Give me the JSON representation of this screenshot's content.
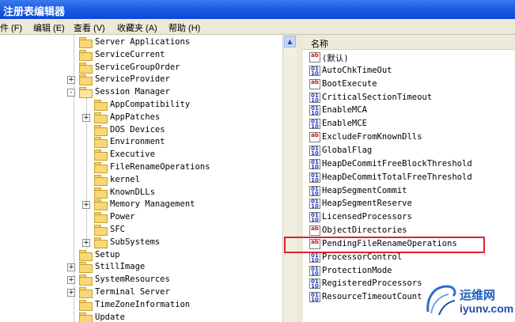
{
  "window": {
    "title": "注册表编辑器"
  },
  "menu": [
    {
      "label": "件 (F)"
    },
    {
      "label": "编辑 (E)"
    },
    {
      "label": "查看 (V)"
    },
    {
      "label": "收藏夹 (A)"
    },
    {
      "label": "帮助 (H)"
    }
  ],
  "tree": {
    "items": [
      {
        "label": "Server Applications",
        "level": 0,
        "expander": ""
      },
      {
        "label": "ServiceCurrent",
        "level": 0,
        "expander": ""
      },
      {
        "label": "ServiceGroupOrder",
        "level": 0,
        "expander": ""
      },
      {
        "label": "ServiceProvider",
        "level": 0,
        "expander": "+"
      },
      {
        "label": "Session Manager",
        "level": 0,
        "expander": "-"
      },
      {
        "label": "AppCompatibility",
        "level": 1,
        "expander": ""
      },
      {
        "label": "AppPatches",
        "level": 1,
        "expander": "+"
      },
      {
        "label": "DOS Devices",
        "level": 1,
        "expander": ""
      },
      {
        "label": "Environment",
        "level": 1,
        "expander": ""
      },
      {
        "label": "Executive",
        "level": 1,
        "expander": ""
      },
      {
        "label": "FileRenameOperations",
        "level": 1,
        "expander": ""
      },
      {
        "label": "kernel",
        "level": 1,
        "expander": ""
      },
      {
        "label": "KnownDLLs",
        "level": 1,
        "expander": ""
      },
      {
        "label": "Memory Management",
        "level": 1,
        "expander": "+"
      },
      {
        "label": "Power",
        "level": 1,
        "expander": ""
      },
      {
        "label": "SFC",
        "level": 1,
        "expander": ""
      },
      {
        "label": "SubSystems",
        "level": 1,
        "expander": "+"
      },
      {
        "label": "Setup",
        "level": 0,
        "expander": ""
      },
      {
        "label": "StillImage",
        "level": 0,
        "expander": "+"
      },
      {
        "label": "SystemResources",
        "level": 0,
        "expander": "+"
      },
      {
        "label": "Terminal Server",
        "level": 0,
        "expander": "+"
      },
      {
        "label": "TimeZoneInformation",
        "level": 0,
        "expander": ""
      },
      {
        "label": "Update",
        "level": 0,
        "expander": ""
      }
    ]
  },
  "values": {
    "column_header": "名称",
    "items": [
      {
        "name": "(默认)",
        "type_icon": "string-value-icon"
      },
      {
        "name": "AutoChkTimeOut",
        "type_icon": "binary-value-icon"
      },
      {
        "name": "BootExecute",
        "type_icon": "string-value-icon"
      },
      {
        "name": "CriticalSectionTimeout",
        "type_icon": "binary-value-icon"
      },
      {
        "name": "EnableMCA",
        "type_icon": "binary-value-icon"
      },
      {
        "name": "EnableMCE",
        "type_icon": "binary-value-icon"
      },
      {
        "name": "ExcludeFromKnownDlls",
        "type_icon": "string-value-icon"
      },
      {
        "name": "GlobalFlag",
        "type_icon": "binary-value-icon"
      },
      {
        "name": "HeapDeCommitFreeBlockThreshold",
        "type_icon": "binary-value-icon"
      },
      {
        "name": "HeapDeCommitTotalFreeThreshold",
        "type_icon": "binary-value-icon"
      },
      {
        "name": "HeapSegmentCommit",
        "type_icon": "binary-value-icon"
      },
      {
        "name": "HeapSegmentReserve",
        "type_icon": "binary-value-icon"
      },
      {
        "name": "LicensedProcessors",
        "type_icon": "binary-value-icon"
      },
      {
        "name": "ObjectDirectories",
        "type_icon": "string-value-icon"
      },
      {
        "name": "PendingFileRenameOperations",
        "type_icon": "string-value-icon"
      },
      {
        "name": "ProcessorControl",
        "type_icon": "binary-value-icon"
      },
      {
        "name": "ProtectionMode",
        "type_icon": "binary-value-icon"
      },
      {
        "name": "RegisteredProcessors",
        "type_icon": "binary-value-icon"
      },
      {
        "name": "ResourceTimeoutCount",
        "type_icon": "binary-value-icon"
      }
    ]
  },
  "watermark": {
    "top": "运维网",
    "bottom": "iyunv.com"
  },
  "colors": {
    "title_bar": "#0b47d8",
    "highlight": "#e1202a",
    "menu_bg": "#ece9d8"
  }
}
